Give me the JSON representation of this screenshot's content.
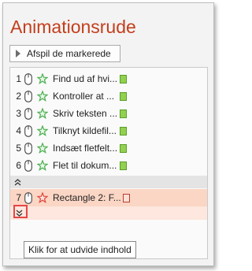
{
  "pane": {
    "title": "Animationsrude",
    "play_button_label": "Afspil de markerede"
  },
  "animations": [
    {
      "number": "1",
      "label": "Find ud af hvi...",
      "trigger_icon": "mouse-click-icon",
      "effect_icon": "entrance-effect-star-icon",
      "effect_color": "#4caf50"
    },
    {
      "number": "2",
      "label": "Kontroller at ...",
      "trigger_icon": "mouse-click-icon",
      "effect_icon": "entrance-effect-star-icon",
      "effect_color": "#4caf50"
    },
    {
      "number": "3",
      "label": "Skriv teksten ...",
      "trigger_icon": "mouse-click-icon",
      "effect_icon": "entrance-effect-star-icon",
      "effect_color": "#4caf50"
    },
    {
      "number": "4",
      "label": "Tilknyt kildefil...",
      "trigger_icon": "mouse-click-icon",
      "effect_icon": "entrance-effect-star-icon",
      "effect_color": "#4caf50"
    },
    {
      "number": "5",
      "label": "Indsæt fletfelt...",
      "trigger_icon": "mouse-click-icon",
      "effect_icon": "entrance-effect-star-icon",
      "effect_color": "#4caf50"
    },
    {
      "number": "6",
      "label": "Flet til dokum...",
      "trigger_icon": "mouse-click-icon",
      "effect_icon": "entrance-effect-star-icon",
      "effect_color": "#4caf50"
    }
  ],
  "collapsed_animation": {
    "number": "7",
    "label": "Rectangle 2: F...",
    "trigger_icon": "mouse-click-icon",
    "effect_icon": "exit-effect-star-icon",
    "effect_color": "#e0453a"
  },
  "tooltip": "Klik for at udvide indhold",
  "colors": {
    "title": "#c43e1c",
    "selected_row": "#fbd6c5",
    "highlight": "#e64545"
  }
}
